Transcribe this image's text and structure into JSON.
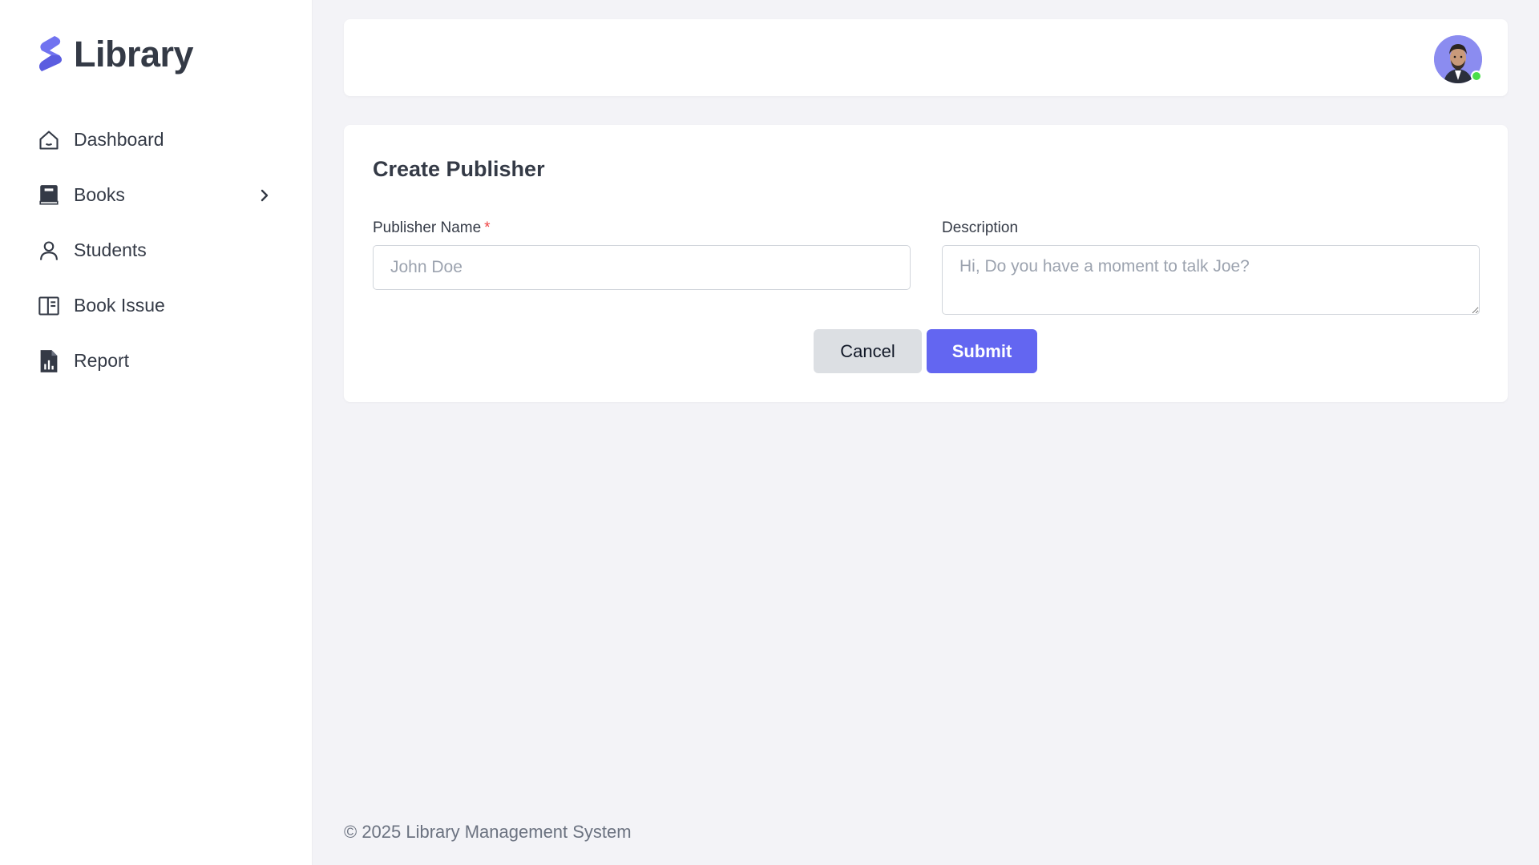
{
  "brand": {
    "name": "Library"
  },
  "sidebar": {
    "items": [
      {
        "label": "Dashboard",
        "icon": "home-icon"
      },
      {
        "label": "Books",
        "icon": "book-icon",
        "has_children": true
      },
      {
        "label": "Students",
        "icon": "user-icon"
      },
      {
        "label": "Book Issue",
        "icon": "book-open-icon"
      },
      {
        "label": "Report",
        "icon": "report-icon"
      }
    ]
  },
  "header": {
    "avatar": {
      "status": "online",
      "status_color": "#4ade4a"
    }
  },
  "form": {
    "title": "Create Publisher",
    "publisher_name": {
      "label": "Publisher Name",
      "required_mark": "*",
      "placeholder": "John Doe",
      "value": ""
    },
    "description": {
      "label": "Description",
      "placeholder": "Hi, Do you have a moment to talk Joe?",
      "value": ""
    },
    "cancel_label": "Cancel",
    "submit_label": "Submit"
  },
  "footer": {
    "text": "© 2025 Library Management System"
  },
  "colors": {
    "accent": "#6366f1",
    "background": "#f3f3f7",
    "text": "#343a46"
  }
}
